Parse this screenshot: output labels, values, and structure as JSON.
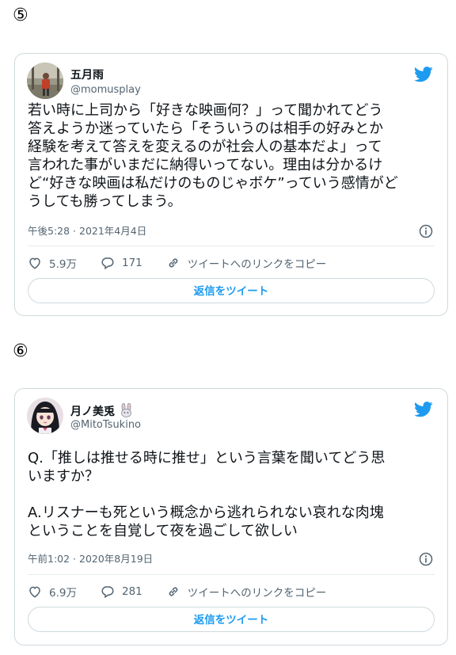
{
  "tweets": [
    {
      "number": "⑤",
      "author_name": "五月雨",
      "handle": "@momusplay",
      "text": "若い時に上司から「好きな映画何？」って聞かれてどう\n答えようか迷っていたら「そういうのは相手の好みとか\n経験を考えて答えを変えるのが社会人の基本だよ」って\n言われた事がいまだに納得いってない。理由は分かるけ\nど“好きな映画は私だけのものじゃボケ”っていう感情がど\nうしても勝ってしまう。",
      "timestamp": "午後5:28 · 2021年4月4日",
      "likes": "5.9万",
      "replies": "171",
      "copy_link": "ツイートへのリンクをコピー",
      "reply_button": "返信をツイート"
    },
    {
      "number": "⑥",
      "author_name": "月ノ美兎",
      "handle": "@MitoTsukino",
      "text": "Q.「推しは推せる時に推せ」という言葉を聞いてどう思\nいますか？\n\nA.リスナーも死という概念から逃れられない哀れな肉塊\nということを自覚して夜を過ごして欲しい",
      "timestamp": "午前1:02 · 2020年8月19日",
      "likes": "6.9万",
      "replies": "281",
      "copy_link": "ツイートへのリンクをコピー",
      "reply_button": "返信をツイート"
    }
  ],
  "colors": {
    "brand": "#1d9bf0",
    "secondary_text": "#536471",
    "border": "#cfd9de"
  }
}
